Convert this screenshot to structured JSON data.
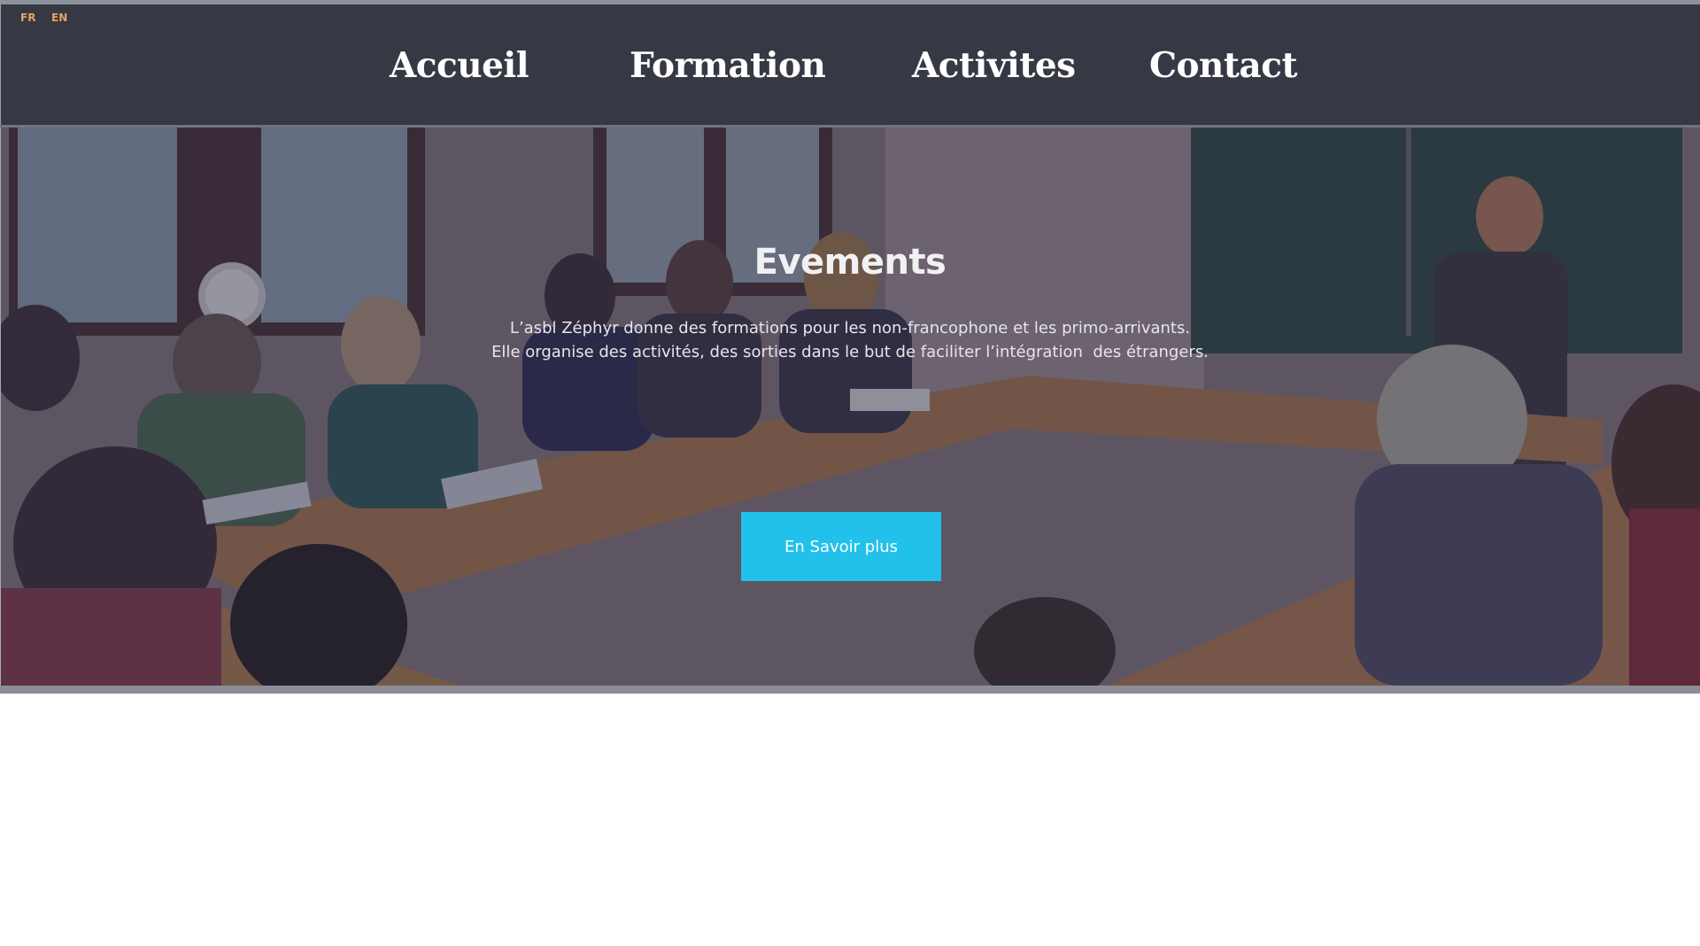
{
  "header": {
    "languages": [
      {
        "label": "FR"
      },
      {
        "label": "EN"
      }
    ],
    "nav": [
      {
        "label": "Accueil"
      },
      {
        "label": "Formation"
      },
      {
        "label": "Activites"
      },
      {
        "label": "Contact"
      }
    ]
  },
  "hero": {
    "title": "Evements",
    "line1": "L’asbl Zéphyr donne des formations pour les non-francophone et les primo-arrivants.",
    "line2": "Elle organise des activités, des sorties dans le but de faciliter l’intégration  des étrangers.",
    "button_label": "En Savoir plus"
  },
  "colors": {
    "header_bg": "#363943",
    "language_link": "#e3a35b",
    "button_bg": "#22c1eb"
  }
}
